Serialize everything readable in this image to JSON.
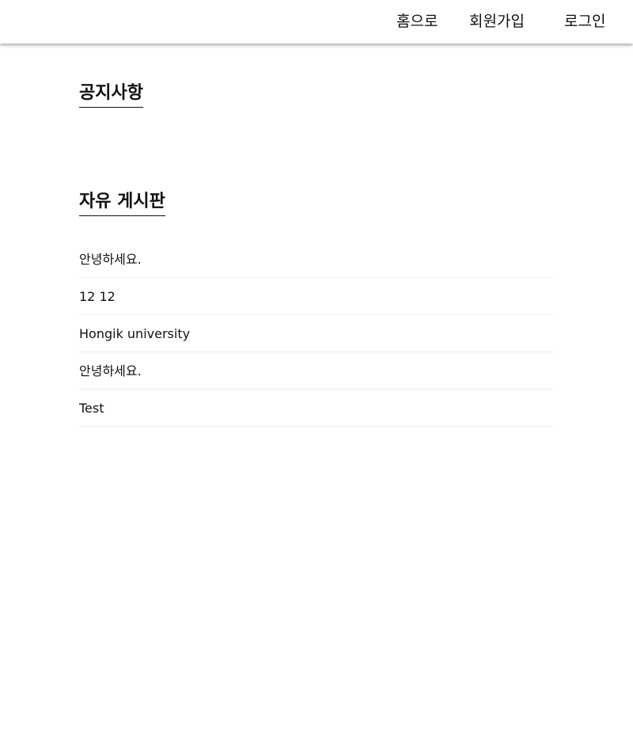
{
  "nav": {
    "home": "홈으로",
    "signup": "회원가입",
    "login": "로그인"
  },
  "notice": {
    "title": "공지사항"
  },
  "board": {
    "title": "자유 게시판",
    "posts": [
      "안녕하세요.",
      "12 12",
      "Hongik university",
      "안녕하세요.",
      "Test"
    ]
  }
}
